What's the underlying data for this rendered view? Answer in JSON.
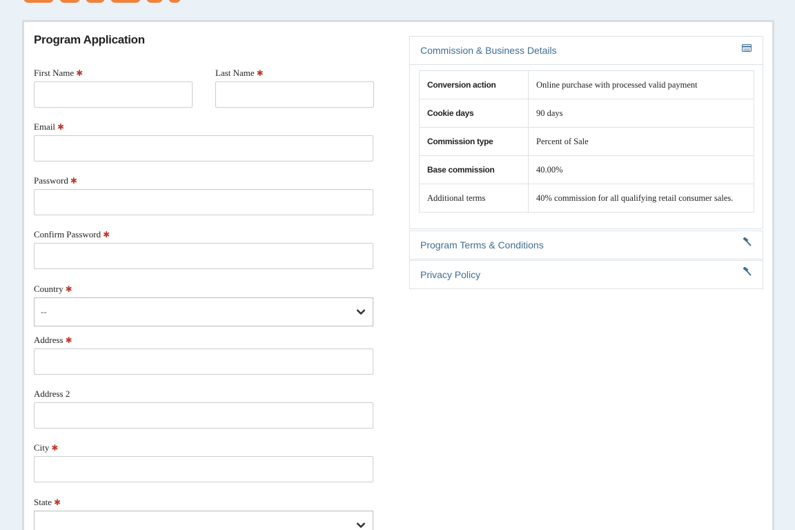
{
  "brand": {
    "logo_text": "popularis",
    "accent": "#e9723a"
  },
  "form": {
    "title": "Program Application",
    "required_mark": "✱",
    "fields": {
      "first_name": {
        "label": "First Name",
        "value": ""
      },
      "last_name": {
        "label": "Last Name",
        "value": ""
      },
      "email": {
        "label": "Email",
        "value": ""
      },
      "password": {
        "label": "Password",
        "value": ""
      },
      "confirm_password": {
        "label": "Confirm Password",
        "value": ""
      },
      "country": {
        "label": "Country",
        "value": "--"
      },
      "address": {
        "label": "Address",
        "value": ""
      },
      "address2": {
        "label": "Address 2",
        "value": ""
      },
      "city": {
        "label": "City",
        "value": ""
      },
      "state": {
        "label": "State",
        "value": ""
      }
    }
  },
  "sidebar": {
    "commission": {
      "heading": "Commission & Business Details",
      "icon": "card-icon",
      "rows": [
        {
          "key": "Conversion action",
          "value": "Online purchase with processed valid payment"
        },
        {
          "key": "Cookie days",
          "value": "90 days"
        },
        {
          "key": "Commission type",
          "value": "Percent of Sale"
        },
        {
          "key": "Base commission",
          "value": "40.00%"
        },
        {
          "key": "Additional terms",
          "value": "40% commission for all qualifying retail consumer sales."
        }
      ]
    },
    "terms": {
      "heading": "Program Terms & Conditions",
      "icon": "gavel-icon"
    },
    "privacy": {
      "heading": "Privacy Policy",
      "icon": "gavel-icon"
    }
  },
  "colors": {
    "link": "#3f6e93",
    "required": "#c0392b",
    "border": "#dde2e6"
  }
}
